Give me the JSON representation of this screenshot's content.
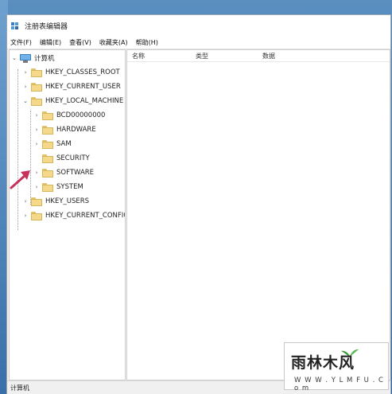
{
  "window": {
    "title": "注册表编辑器",
    "app_icon": "regedit-icon"
  },
  "menu": {
    "items": [
      "文件(F)",
      "编辑(E)",
      "查看(V)",
      "收藏夹(A)",
      "帮助(H)"
    ]
  },
  "tree": {
    "root": "计算机",
    "nodes": [
      {
        "label": "HKEY_CLASSES_ROOT",
        "expander": "›"
      },
      {
        "label": "HKEY_CURRENT_USER",
        "expander": "›"
      },
      {
        "label": "HKEY_LOCAL_MACHINE",
        "expander": "⌄"
      },
      {
        "label": "BCD00000000",
        "expander": "›"
      },
      {
        "label": "HARDWARE",
        "expander": "›"
      },
      {
        "label": "SAM",
        "expander": "›"
      },
      {
        "label": "SECURITY",
        "expander": ""
      },
      {
        "label": "SOFTWARE",
        "expander": "›"
      },
      {
        "label": "SYSTEM",
        "expander": "›"
      },
      {
        "label": "HKEY_USERS",
        "expander": "›"
      },
      {
        "label": "HKEY_CURRENT_CONFIG",
        "expander": "›"
      }
    ]
  },
  "list": {
    "columns": [
      "名称",
      "类型",
      "数据"
    ]
  },
  "status": {
    "path": "计算机"
  },
  "watermark": {
    "title": "雨林木风",
    "url": "W W W . Y L M F U . C o m"
  },
  "colors": {
    "folder": "#f4d98a",
    "arrow": "#c8325a",
    "desktop": "#3f78b0"
  }
}
